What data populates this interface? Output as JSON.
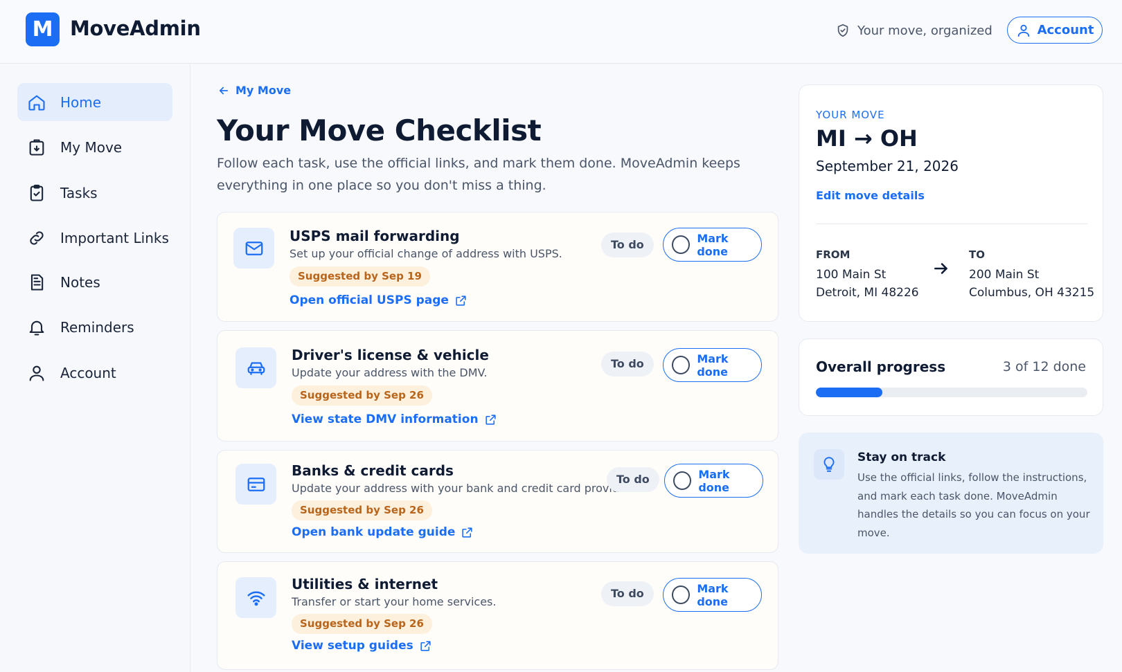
{
  "brand": {
    "logo_letter": "M",
    "name": "MoveAdmin"
  },
  "header": {
    "tagline": "Your move, organized",
    "account_label": "Account"
  },
  "sidebar": {
    "items": [
      {
        "label": "Home",
        "icon": "home-icon",
        "active": true
      },
      {
        "label": "My Move",
        "icon": "box-icon",
        "active": false
      },
      {
        "label": "Tasks",
        "icon": "clipboard-check-icon",
        "active": false
      },
      {
        "label": "Important Links",
        "icon": "link-icon",
        "active": false
      },
      {
        "label": "Notes",
        "icon": "notes-icon",
        "active": false
      },
      {
        "label": "Reminders",
        "icon": "bell-icon",
        "active": false
      },
      {
        "label": "Account",
        "icon": "user-icon",
        "active": false
      }
    ]
  },
  "main": {
    "breadcrumb": "My Move",
    "title": "Your Move Checklist",
    "subtitle": "Follow each task, use the official links, and mark them done. MoveAdmin keeps everything in one place so you don't miss a thing.",
    "tasks": [
      {
        "icon": "mail-icon",
        "name": "USPS mail forwarding",
        "description": "Set up your official change of address with USPS.",
        "suggested": "Suggested by Sep 19",
        "link": "Open official USPS page",
        "status": "To do",
        "action": "Mark done"
      },
      {
        "icon": "car-icon",
        "name": "Driver's license & vehicle",
        "description": "Update your address with the DMV.",
        "suggested": "Suggested by Sep 26",
        "link": "View state DMV information",
        "status": "To do",
        "action": "Mark done"
      },
      {
        "icon": "credit-card-icon",
        "name": "Banks & credit cards",
        "description": "Update your address with your bank and credit card providers.",
        "suggested": "Suggested by Sep 26",
        "link": "Open bank update guide",
        "status": "To do",
        "action": "Mark done"
      },
      {
        "icon": "wifi-icon",
        "name": "Utilities & internet",
        "description": "Transfer or start your home services.",
        "suggested": "Suggested by Sep 26",
        "link": "View setup guides",
        "status": "To do",
        "action": "Mark done"
      }
    ]
  },
  "move_card": {
    "label": "YOUR MOVE",
    "route": "MI → OH",
    "date": "September 21, 2026",
    "edit_label": "Edit move details",
    "from_label": "FROM",
    "from_line1": "100 Main St",
    "from_line2": "Detroit, MI 48226",
    "to_label": "TO",
    "to_line1": "200 Main St",
    "to_line2": "Columbus, OH 43215"
  },
  "progress": {
    "title": "Overall progress",
    "count_text": "3 of 12 done",
    "fraction": 0.245
  },
  "tip": {
    "title": "Stay on track",
    "body": "Use the official links, follow the instructions, and mark each task done. MoveAdmin handles the details so you can focus on your move."
  },
  "colors": {
    "accent": "#1b6ef3",
    "badge_bg": "#fdf0dc",
    "badge_text": "#b8651b"
  }
}
